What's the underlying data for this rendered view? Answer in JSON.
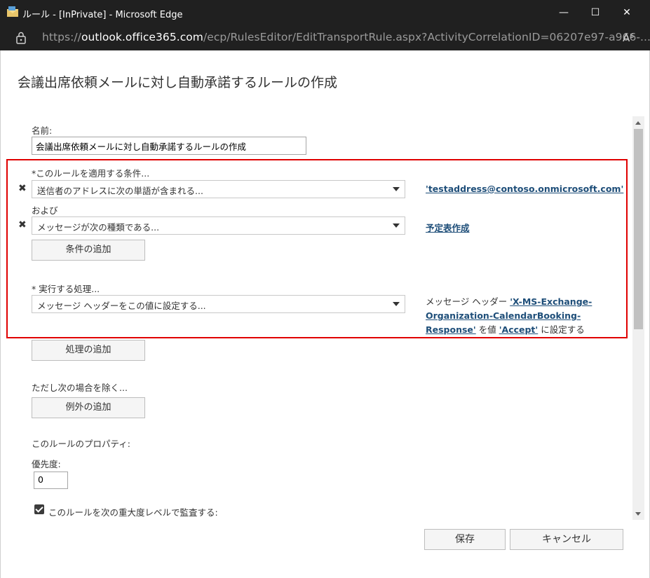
{
  "window": {
    "title": "ルール - [InPrivate] - Microsoft Edge",
    "min_glyph": "—",
    "max_glyph": "☐",
    "close_glyph": "✕"
  },
  "address": {
    "prefix": "https://",
    "host": "outlook.office365.com",
    "path": "/ecp/RulesEditor/EditTransportRule.aspx?ActivityCorrelationID=06207e97-a966-...",
    "read_aloud": "A⁵"
  },
  "dialog": {
    "title": "会議出席依頼メールに対し自動承諾するルールの作成"
  },
  "form": {
    "name_label": "名前:",
    "name_value": "会議出席依頼メールに対し自動承諾するルールの作成",
    "conditions_label": "*このルールを適用する条件...",
    "condition1": "送信者のアドレスに次の単語が含まれる...",
    "condition1_value": "'testaddress@contoso.onmicrosoft.com'",
    "and_label": "および",
    "condition2": "メッセージが次の種類である...",
    "condition2_value": "予定表作成",
    "add_condition": "条件の追加",
    "actions_label": "* 実行する処理...",
    "action1": "メッセージ ヘッダーをこの値に設定する...",
    "action_desc": {
      "prefix": "メッセージ ヘッダー ",
      "header_link": "'X-MS-Exchange-Organization-CalendarBooking-Response'",
      "mid": " を値 ",
      "value_link": "'Accept'",
      "suffix": " に設定する"
    },
    "add_action": "処理の追加",
    "except_label": "ただし次の場合を除く...",
    "add_exception": "例外の追加",
    "properties_label": "このルールのプロパティ:",
    "priority_label": "優先度:",
    "priority_value": "0",
    "audit_label": "このルールを次の重大度レベルで監査する:",
    "remove_glyph": "✖"
  },
  "footer": {
    "save": "保存",
    "cancel": "キャンセル"
  },
  "colors": {
    "highlight_box": "#e00000",
    "link": "#1e4e79",
    "titlebar": "#202020"
  }
}
